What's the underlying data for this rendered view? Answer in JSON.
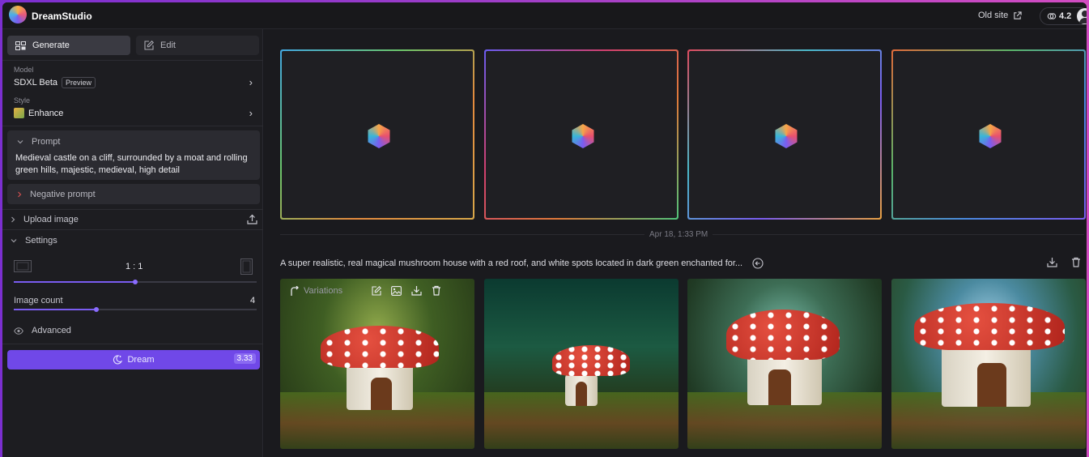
{
  "app": {
    "title": "DreamStudio"
  },
  "header": {
    "old_site_label": "Old site",
    "credits": "4.2"
  },
  "sidebar": {
    "tabs": [
      {
        "label": "Generate",
        "active": true
      },
      {
        "label": "Edit",
        "active": false
      }
    ],
    "model": {
      "label": "Model",
      "value": "SDXL Beta",
      "badge": "Preview"
    },
    "style": {
      "label": "Style",
      "value": "Enhance"
    },
    "prompt": {
      "label": "Prompt",
      "text": "Medieval castle on a cliff, surrounded by a moat and rolling green hills, majestic, medieval, high detail"
    },
    "negative_prompt": {
      "label": "Negative prompt"
    },
    "upload_image": {
      "label": "Upload image"
    },
    "settings": {
      "label": "Settings",
      "aspect_ratio": "1 : 1",
      "aspect_slider_fraction": 0.5,
      "image_count_label": "Image count",
      "image_count": "4",
      "image_count_fraction": 0.34,
      "advanced_label": "Advanced"
    },
    "dream_button": {
      "label": "Dream",
      "cost": "3.33"
    }
  },
  "main": {
    "pending_placeholders": 4,
    "batch": {
      "timestamp": "Apr 18, 1:33 PM",
      "prompt": "A super realistic, real magical mushroom house with a red roof, and white spots located in dark green enchanted for...",
      "hover_toolbar": {
        "variations_label": "Variations"
      },
      "images": [
        {
          "name": "mushroom-house-1"
        },
        {
          "name": "mushroom-house-2"
        },
        {
          "name": "mushroom-house-3"
        },
        {
          "name": "mushroom-house-4"
        }
      ]
    }
  },
  "colors": {
    "accent": "#7048e8",
    "background": "#18181c",
    "sidebar": "#1d1d21"
  }
}
